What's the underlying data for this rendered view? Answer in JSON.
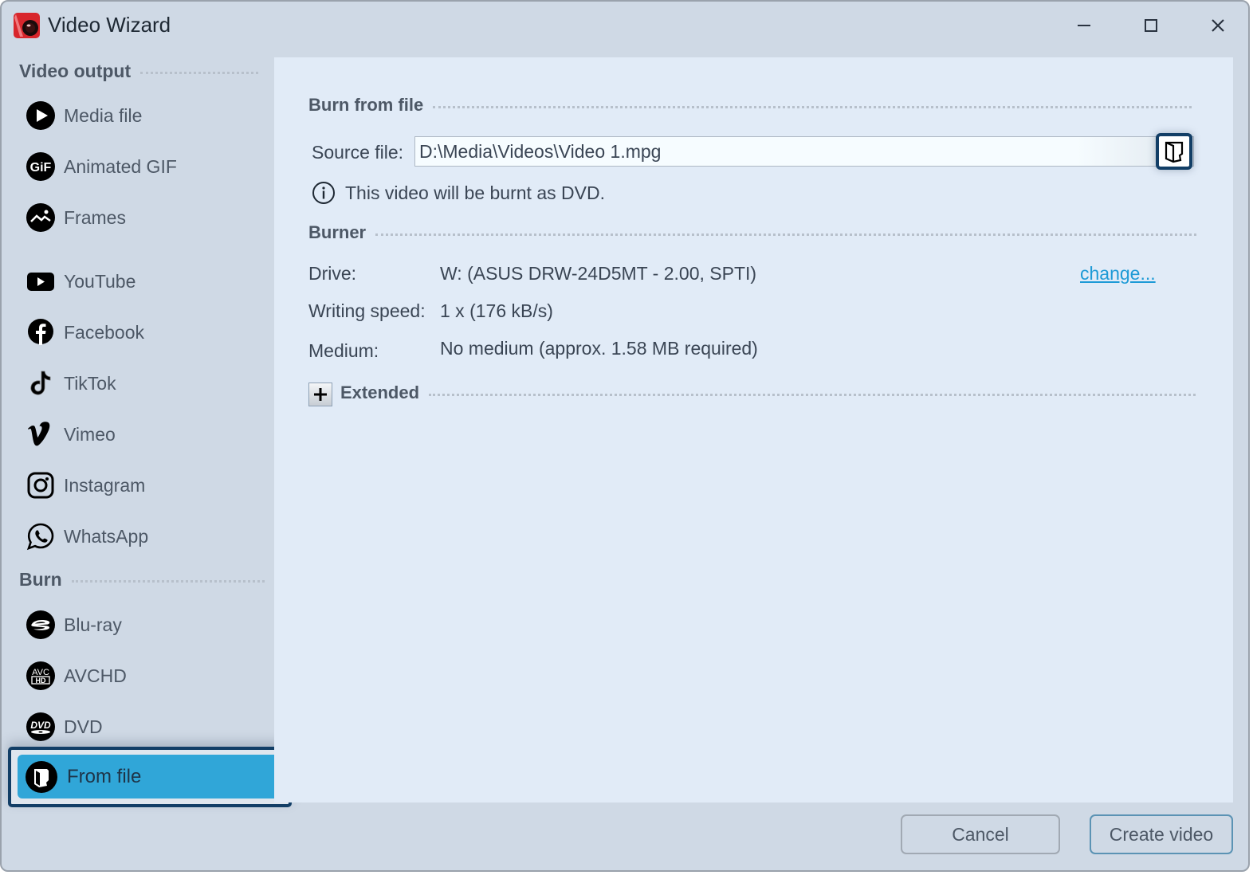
{
  "window": {
    "title": "Video Wizard",
    "controls": [
      "minimize",
      "maximize",
      "close"
    ]
  },
  "sidebar": {
    "sections": [
      {
        "heading": "Video output",
        "items": [
          {
            "label": "Media file",
            "icon": "play-circle-icon"
          },
          {
            "label": "Animated GIF",
            "icon": "gif-icon"
          },
          {
            "label": "Frames",
            "icon": "image-icon"
          },
          {
            "label": "YouTube",
            "icon": "youtube-icon"
          },
          {
            "label": "Facebook",
            "icon": "facebook-icon"
          },
          {
            "label": "TikTok",
            "icon": "tiktok-icon"
          },
          {
            "label": "Vimeo",
            "icon": "vimeo-icon"
          },
          {
            "label": "Instagram",
            "icon": "instagram-icon"
          },
          {
            "label": "WhatsApp",
            "icon": "whatsapp-icon"
          }
        ]
      },
      {
        "heading": "Burn",
        "items": [
          {
            "label": "Blu-ray",
            "icon": "bluray-icon"
          },
          {
            "label": "AVCHD",
            "icon": "avchd-icon"
          },
          {
            "label": "DVD",
            "icon": "dvd-icon"
          },
          {
            "label": "From file",
            "icon": "open-file-icon",
            "selected": true
          }
        ]
      }
    ]
  },
  "main": {
    "burn_from_file": {
      "heading": "Burn from file",
      "source_label": "Source file:",
      "source_value": "D:\\Media\\Videos\\Video 1.mpg",
      "info_text": "This video will be burnt as DVD."
    },
    "burner": {
      "heading": "Burner",
      "drive_label": "Drive:",
      "drive_value": "W: (ASUS DRW-24D5MT - 2.00, SPTI)",
      "change_link": "change...",
      "speed_label": "Writing speed:",
      "speed_value": "1 x (176 kB/s)",
      "medium_label": "Medium:",
      "medium_value": "No medium (approx. 1.58 MB required)"
    },
    "extended": {
      "heading": "Extended",
      "expanded": false
    }
  },
  "footer": {
    "cancel_label": "Cancel",
    "create_label": "Create video"
  },
  "colors": {
    "selected_bg": "#30a6d8",
    "focus_border": "#123e66",
    "link": "#1d9ad6",
    "panel_bg": "#e1ebf7",
    "window_bg": "#cfd9e5"
  }
}
